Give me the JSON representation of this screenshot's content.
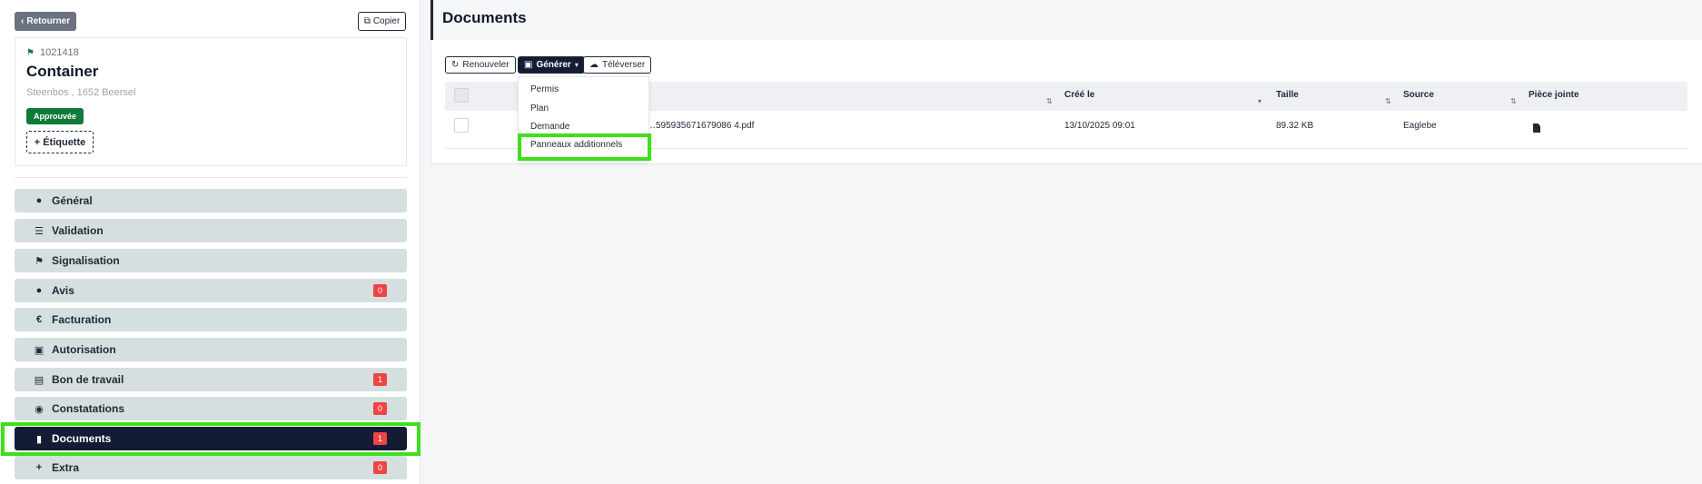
{
  "left": {
    "back_label": "Retourner",
    "copy_label": "Copier",
    "card": {
      "id": "1021418",
      "title": "Container",
      "address": "Steenbos , 1652 Beersel",
      "status_badge": "Approuvée",
      "add_tag_label": "+ Étiquette"
    },
    "nav": [
      {
        "label": "Général",
        "icon": "info-icon"
      },
      {
        "label": "Validation",
        "icon": "checklist-icon"
      },
      {
        "label": "Signalisation",
        "icon": "signpost-icon"
      },
      {
        "label": "Avis",
        "icon": "comment-icon",
        "count": "0"
      },
      {
        "label": "Facturation",
        "icon": "euro-icon"
      },
      {
        "label": "Autorisation",
        "icon": "file-signature-icon"
      },
      {
        "label": "Bon de travail",
        "icon": "file-text-icon",
        "count": "1"
      },
      {
        "label": "Constatations",
        "icon": "eye-icon",
        "count": "0"
      },
      {
        "label": "Documents",
        "icon": "file-icon",
        "count": "1",
        "active": true
      },
      {
        "label": "Extra",
        "icon": "plus-icon",
        "count": "0"
      }
    ]
  },
  "main": {
    "title": "Documents",
    "toolbar": {
      "renew_label": "Renouveler",
      "generate_label": "Générer",
      "upload_label": "Téléverser"
    },
    "dropdown": [
      "Permis",
      "Plan",
      "Demande",
      "Panneaux additionnels"
    ],
    "table": {
      "columns": [
        "Créé le",
        "Taille",
        "Source",
        "Pièce jointe"
      ],
      "rows": [
        {
          "name": "…595935671679086 4.pdf",
          "created": "13/10/2025 09:01",
          "size": "89.32 KB",
          "source": "Eaglebe"
        }
      ]
    }
  },
  "colors": {
    "accent_dark": "#141c35",
    "highlight": "#3ee019",
    "approved": "#0f7a3a",
    "count_badge": "#ef4444",
    "nav_bg": "#d5dfdf"
  }
}
